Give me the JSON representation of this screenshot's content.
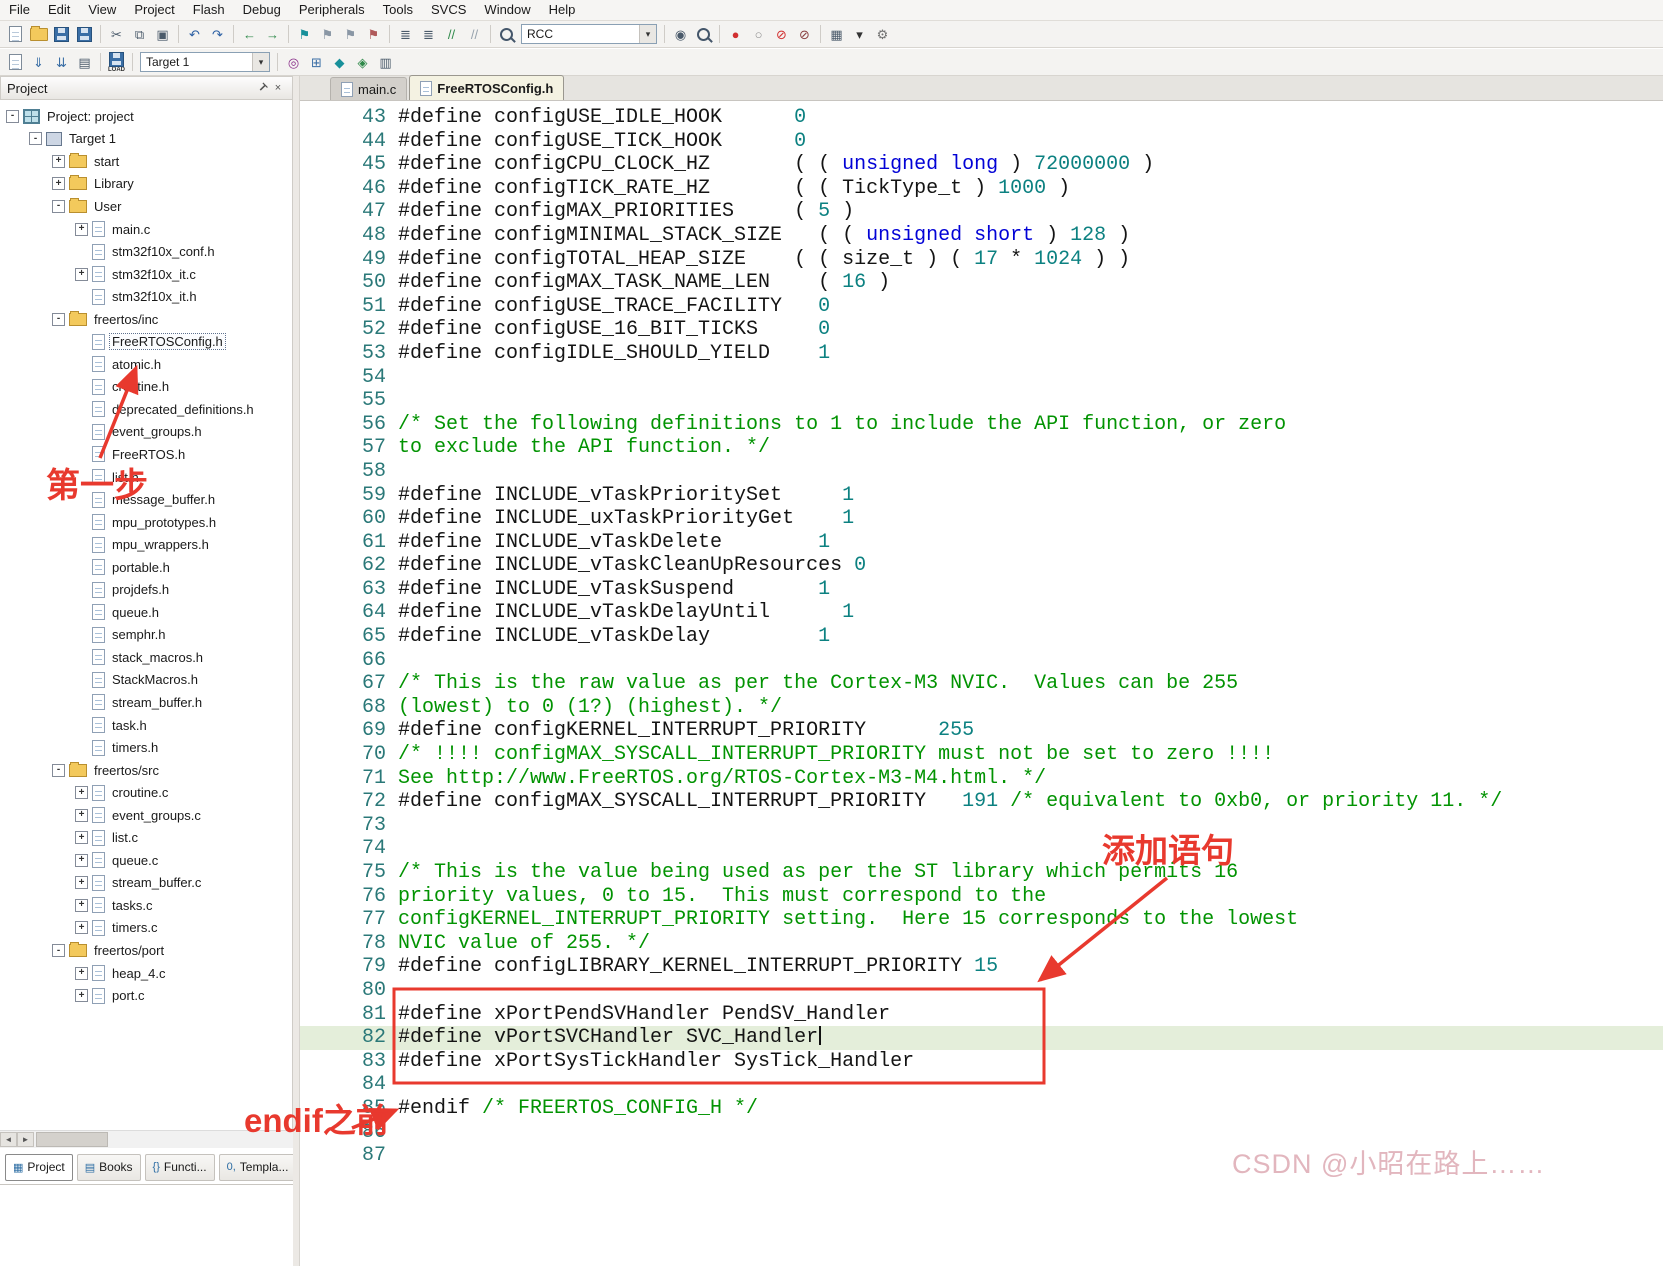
{
  "menubar": {
    "items": [
      "File",
      "Edit",
      "View",
      "Project",
      "Flash",
      "Debug",
      "Peripherals",
      "Tools",
      "SVCS",
      "Window",
      "Help"
    ]
  },
  "toolbars": {
    "row1": [
      {
        "n": "new-file-button",
        "k": "paper"
      },
      {
        "n": "open-file-button",
        "k": "folder"
      },
      {
        "n": "save-button",
        "k": "disk"
      },
      {
        "n": "save-all-button",
        "k": "disk"
      },
      {
        "k": "sep"
      },
      {
        "n": "cut-button",
        "k": "g",
        "g": "✂",
        "c": "#4a5a6a"
      },
      {
        "n": "copy-button",
        "k": "g",
        "g": "⧉",
        "c": "#4a5a6a"
      },
      {
        "n": "paste-button",
        "k": "g",
        "g": "▣",
        "c": "#4a5a6a"
      },
      {
        "k": "sep"
      },
      {
        "n": "undo-button",
        "k": "g",
        "g": "↶",
        "c": "#2b5fa3"
      },
      {
        "n": "redo-button",
        "k": "g",
        "g": "↷",
        "c": "#2b5fa3"
      },
      {
        "k": "sep"
      },
      {
        "n": "nav-back-button",
        "k": "g",
        "g": "←",
        "c": "#2f8a4a"
      },
      {
        "n": "nav-forward-button",
        "k": "g",
        "g": "→",
        "c": "#2f8a4a"
      },
      {
        "k": "sep"
      },
      {
        "n": "bookmark-toggle-button",
        "k": "g",
        "g": "⚑",
        "c": "#18909a"
      },
      {
        "n": "bookmark-prev-button",
        "k": "g",
        "g": "⚑",
        "c": "#8a97a5"
      },
      {
        "n": "bookmark-next-button",
        "k": "g",
        "g": "⚑",
        "c": "#8a97a5"
      },
      {
        "n": "bookmark-clear-button",
        "k": "g",
        "g": "⚑",
        "c": "#b05a5a"
      },
      {
        "k": "sep"
      },
      {
        "n": "indent-left-button",
        "k": "g",
        "g": "≣",
        "c": "#4a5a6a"
      },
      {
        "n": "indent-right-button",
        "k": "g",
        "g": "≣",
        "c": "#4a5a6a"
      },
      {
        "n": "comment-button",
        "k": "g",
        "g": "//",
        "c": "#2f8a4a"
      },
      {
        "n": "uncomment-button",
        "k": "g",
        "g": "//",
        "c": "#97a2ad"
      },
      {
        "k": "sep"
      },
      {
        "n": "find-icon-button",
        "k": "mag"
      },
      {
        "n": "find-combo",
        "k": "combo",
        "v": "RCC",
        "a": "▾",
        "w": 136
      },
      {
        "k": "sep"
      },
      {
        "n": "find-in-files-button",
        "k": "g",
        "g": "◉",
        "c": "#4a5a6a"
      },
      {
        "n": "search-button",
        "k": "mag"
      },
      {
        "k": "sep"
      },
      {
        "n": "breakpoint-toggle-button",
        "k": "g",
        "g": "●",
        "c": "#d23030"
      },
      {
        "n": "breakpoint-enable-button",
        "k": "g",
        "g": "○",
        "c": "#909090"
      },
      {
        "n": "breakpoint-disable-all-button",
        "k": "g",
        "g": "⊘",
        "c": "#d23030"
      },
      {
        "n": "breakpoint-kill-all-button",
        "k": "g",
        "g": "⊘",
        "c": "#8a4040"
      },
      {
        "k": "sep"
      },
      {
        "n": "window-layout-button",
        "k": "g",
        "g": "▦",
        "c": "#4a5a6a"
      },
      {
        "n": "window-layout-arrow-button",
        "k": "g",
        "g": "▾",
        "c": "#333333"
      },
      {
        "n": "configuration-button",
        "k": "g",
        "g": "⚙",
        "c": "#707070"
      }
    ],
    "row2": [
      {
        "n": "translate-button",
        "k": "paper"
      },
      {
        "n": "build-button",
        "k": "g",
        "g": "⇓",
        "c": "#3a6ea5"
      },
      {
        "n": "rebuild-button",
        "k": "g",
        "g": "⇊",
        "c": "#3a6ea5"
      },
      {
        "n": "batch-build-button",
        "k": "g",
        "g": "▤",
        "c": "#4a5a6a"
      },
      {
        "k": "sep"
      },
      {
        "n": "download-button",
        "k": "load",
        "g": "LOAD"
      },
      {
        "k": "sep"
      },
      {
        "n": "target-select",
        "k": "combo",
        "v": "Target 1",
        "a": "▾",
        "w": 130
      },
      {
        "k": "sep"
      },
      {
        "n": "options-for-target-button",
        "k": "g",
        "g": "◎",
        "c": "#8a2f8a"
      },
      {
        "n": "manage-project-items-button",
        "k": "g",
        "g": "⊞",
        "c": "#3a6ea5"
      },
      {
        "n": "manage-runtime-env-button",
        "k": "g",
        "g": "◆",
        "c": "#18909a"
      },
      {
        "n": "pack-installer-button",
        "k": "g",
        "g": "◈",
        "c": "#2f8a4a"
      },
      {
        "n": "books-button",
        "k": "g",
        "g": "▥",
        "c": "#4a5a6a"
      }
    ]
  },
  "project_panel": {
    "title": "Project",
    "pin_glyph": "T",
    "close_glyph": "×",
    "scroll_left_glyph": "◄",
    "scroll_right_glyph": "►",
    "tree": [
      {
        "l": "Project: project",
        "lvl": 0,
        "ic": "ws",
        "bx": "-"
      },
      {
        "l": "Target 1",
        "lvl": 1,
        "ic": "target",
        "bx": "-"
      },
      {
        "l": "start",
        "lvl": 2,
        "ic": "folder",
        "bx": "+"
      },
      {
        "l": "Library",
        "lvl": 2,
        "ic": "folder",
        "bx": "+"
      },
      {
        "l": "User",
        "lvl": 2,
        "ic": "folder",
        "bx": "-"
      },
      {
        "l": "main.c",
        "lvl": 3,
        "ic": "file",
        "bx": "+"
      },
      {
        "l": "stm32f10x_conf.h",
        "lvl": 3,
        "ic": "file"
      },
      {
        "l": "stm32f10x_it.c",
        "lvl": 3,
        "ic": "file",
        "bx": "+"
      },
      {
        "l": "stm32f10x_it.h",
        "lvl": 3,
        "ic": "file"
      },
      {
        "l": "freertos/inc",
        "lvl": 2,
        "ic": "folder",
        "bx": "-"
      },
      {
        "l": "FreeRTOSConfig.h",
        "lvl": 3,
        "ic": "file",
        "sel": true
      },
      {
        "l": "atomic.h",
        "lvl": 3,
        "ic": "file"
      },
      {
        "l": "croutine.h",
        "lvl": 3,
        "ic": "file"
      },
      {
        "l": "deprecated_definitions.h",
        "lvl": 3,
        "ic": "file"
      },
      {
        "l": "event_groups.h",
        "lvl": 3,
        "ic": "file"
      },
      {
        "l": "FreeRTOS.h",
        "lvl": 3,
        "ic": "file"
      },
      {
        "l": "list.h",
        "lvl": 3,
        "ic": "file"
      },
      {
        "l": "message_buffer.h",
        "lvl": 3,
        "ic": "file"
      },
      {
        "l": "mpu_prototypes.h",
        "lvl": 3,
        "ic": "file"
      },
      {
        "l": "mpu_wrappers.h",
        "lvl": 3,
        "ic": "file"
      },
      {
        "l": "portable.h",
        "lvl": 3,
        "ic": "file"
      },
      {
        "l": "projdefs.h",
        "lvl": 3,
        "ic": "file"
      },
      {
        "l": "queue.h",
        "lvl": 3,
        "ic": "file"
      },
      {
        "l": "semphr.h",
        "lvl": 3,
        "ic": "file"
      },
      {
        "l": "stack_macros.h",
        "lvl": 3,
        "ic": "file"
      },
      {
        "l": "StackMacros.h",
        "lvl": 3,
        "ic": "file"
      },
      {
        "l": "stream_buffer.h",
        "lvl": 3,
        "ic": "file"
      },
      {
        "l": "task.h",
        "lvl": 3,
        "ic": "file"
      },
      {
        "l": "timers.h",
        "lvl": 3,
        "ic": "file"
      },
      {
        "l": "freertos/src",
        "lvl": 2,
        "ic": "folder",
        "bx": "-"
      },
      {
        "l": "croutine.c",
        "lvl": 3,
        "ic": "file",
        "bx": "+"
      },
      {
        "l": "event_groups.c",
        "lvl": 3,
        "ic": "file",
        "bx": "+"
      },
      {
        "l": "list.c",
        "lvl": 3,
        "ic": "file",
        "bx": "+"
      },
      {
        "l": "queue.c",
        "lvl": 3,
        "ic": "file",
        "bx": "+"
      },
      {
        "l": "stream_buffer.c",
        "lvl": 3,
        "ic": "file",
        "bx": "+"
      },
      {
        "l": "tasks.c",
        "lvl": 3,
        "ic": "file",
        "bx": "+"
      },
      {
        "l": "timers.c",
        "lvl": 3,
        "ic": "file",
        "bx": "+"
      },
      {
        "l": "freertos/port",
        "lvl": 2,
        "ic": "folder",
        "bx": "-"
      },
      {
        "l": "heap_4.c",
        "lvl": 3,
        "ic": "file",
        "bx": "+"
      },
      {
        "l": "port.c",
        "lvl": 3,
        "ic": "file",
        "bx": "+"
      }
    ]
  },
  "editor": {
    "tabs": [
      {
        "label": "main.c"
      },
      {
        "label": "FreeRTOSConfig.h",
        "active": true
      }
    ],
    "lines": [
      {
        "n": 43,
        "s": [
          [
            "p",
            "#define configUSE_IDLE_HOOK      "
          ],
          [
            "n",
            "0"
          ]
        ]
      },
      {
        "n": 44,
        "s": [
          [
            "p",
            "#define configUSE_TICK_HOOK      "
          ],
          [
            "n",
            "0"
          ]
        ]
      },
      {
        "n": 45,
        "s": [
          [
            "p",
            "#define configCPU_CLOCK_HZ       ( ( "
          ],
          [
            "k",
            "unsigned long"
          ],
          [
            "p",
            " ) "
          ],
          [
            "n",
            "72000000"
          ],
          [
            "p",
            " )"
          ]
        ]
      },
      {
        "n": 46,
        "s": [
          [
            "p",
            "#define configTICK_RATE_HZ       ( ( TickType_t ) "
          ],
          [
            "n",
            "1000"
          ],
          [
            "p",
            " )"
          ]
        ]
      },
      {
        "n": 47,
        "s": [
          [
            "p",
            "#define configMAX_PRIORITIES     ( "
          ],
          [
            "n",
            "5"
          ],
          [
            "p",
            " )"
          ]
        ]
      },
      {
        "n": 48,
        "s": [
          [
            "p",
            "#define configMINIMAL_STACK_SIZE   ( ( "
          ],
          [
            "k",
            "unsigned short"
          ],
          [
            "p",
            " ) "
          ],
          [
            "n",
            "128"
          ],
          [
            "p",
            " )"
          ]
        ]
      },
      {
        "n": 49,
        "s": [
          [
            "p",
            "#define configTOTAL_HEAP_SIZE    ( ( size_t ) ( "
          ],
          [
            "n",
            "17"
          ],
          [
            "p",
            " * "
          ],
          [
            "n",
            "1024"
          ],
          [
            "p",
            " ) )"
          ]
        ]
      },
      {
        "n": 50,
        "s": [
          [
            "p",
            "#define configMAX_TASK_NAME_LEN    ( "
          ],
          [
            "n",
            "16"
          ],
          [
            "p",
            " )"
          ]
        ]
      },
      {
        "n": 51,
        "s": [
          [
            "p",
            "#define configUSE_TRACE_FACILITY   "
          ],
          [
            "n",
            "0"
          ]
        ]
      },
      {
        "n": 52,
        "s": [
          [
            "p",
            "#define configUSE_16_BIT_TICKS     "
          ],
          [
            "n",
            "0"
          ]
        ]
      },
      {
        "n": 53,
        "s": [
          [
            "p",
            "#define configIDLE_SHOULD_YIELD    "
          ],
          [
            "n",
            "1"
          ]
        ]
      },
      {
        "n": 54,
        "s": []
      },
      {
        "n": 55,
        "s": []
      },
      {
        "n": 56,
        "s": [
          [
            "c",
            "/* Set the following definitions to 1 to include the API function, or zero"
          ]
        ]
      },
      {
        "n": 57,
        "s": [
          [
            "c",
            "to exclude the API function. */"
          ]
        ]
      },
      {
        "n": 58,
        "s": []
      },
      {
        "n": 59,
        "s": [
          [
            "p",
            "#define INCLUDE_vTaskPrioritySet     "
          ],
          [
            "n",
            "1"
          ]
        ]
      },
      {
        "n": 60,
        "s": [
          [
            "p",
            "#define INCLUDE_uxTaskPriorityGet    "
          ],
          [
            "n",
            "1"
          ]
        ]
      },
      {
        "n": 61,
        "s": [
          [
            "p",
            "#define INCLUDE_vTaskDelete        "
          ],
          [
            "n",
            "1"
          ]
        ]
      },
      {
        "n": 62,
        "s": [
          [
            "p",
            "#define INCLUDE_vTaskCleanUpResources "
          ],
          [
            "n",
            "0"
          ]
        ]
      },
      {
        "n": 63,
        "s": [
          [
            "p",
            "#define INCLUDE_vTaskSuspend       "
          ],
          [
            "n",
            "1"
          ]
        ]
      },
      {
        "n": 64,
        "s": [
          [
            "p",
            "#define INCLUDE_vTaskDelayUntil      "
          ],
          [
            "n",
            "1"
          ]
        ]
      },
      {
        "n": 65,
        "s": [
          [
            "p",
            "#define INCLUDE_vTaskDelay         "
          ],
          [
            "n",
            "1"
          ]
        ]
      },
      {
        "n": 66,
        "s": []
      },
      {
        "n": 67,
        "s": [
          [
            "c",
            "/* This is the raw value as per the Cortex-M3 NVIC.  Values can be 255"
          ]
        ]
      },
      {
        "n": 68,
        "s": [
          [
            "c",
            "(lowest) to 0 (1?) (highest). */"
          ]
        ]
      },
      {
        "n": 69,
        "s": [
          [
            "p",
            "#define configKERNEL_INTERRUPT_PRIORITY      "
          ],
          [
            "n",
            "255"
          ]
        ]
      },
      {
        "n": 70,
        "s": [
          [
            "c",
            "/* !!!! configMAX_SYSCALL_INTERRUPT_PRIORITY must not be set to zero !!!!"
          ]
        ]
      },
      {
        "n": 71,
        "s": [
          [
            "c",
            "See http://www.FreeRTOS.org/RTOS-Cortex-M3-M4.html. */"
          ]
        ]
      },
      {
        "n": 72,
        "s": [
          [
            "p",
            "#define configMAX_SYSCALL_INTERRUPT_PRIORITY   "
          ],
          [
            "n",
            "191"
          ],
          [
            "p",
            " "
          ],
          [
            "c",
            "/* equivalent to 0xb0, or priority 11. */"
          ]
        ]
      },
      {
        "n": 73,
        "s": []
      },
      {
        "n": 74,
        "s": []
      },
      {
        "n": 75,
        "s": [
          [
            "c",
            "/* This is the value being used as per the ST library which permits 16"
          ]
        ]
      },
      {
        "n": 76,
        "s": [
          [
            "c",
            "priority values, 0 to 15.  This must correspond to the"
          ]
        ]
      },
      {
        "n": 77,
        "s": [
          [
            "c",
            "configKERNEL_INTERRUPT_PRIORITY setting.  Here 15 corresponds to the lowest"
          ]
        ]
      },
      {
        "n": 78,
        "s": [
          [
            "c",
            "NVIC value of 255. */"
          ]
        ]
      },
      {
        "n": 79,
        "s": [
          [
            "p",
            "#define configLIBRARY_KERNEL_INTERRUPT_PRIORITY "
          ],
          [
            "n",
            "15"
          ]
        ]
      },
      {
        "n": 80,
        "s": []
      },
      {
        "n": 81,
        "s": [
          [
            "p",
            "#define xPortPendSVHandler PendSV_Handler"
          ]
        ]
      },
      {
        "n": 82,
        "s": [
          [
            "p",
            "#define vPortSVCHandler SVC_Handler"
          ]
        ],
        "hl": true,
        "caret": true
      },
      {
        "n": 83,
        "s": [
          [
            "p",
            "#define xPortSysTickHandler SysTick_Handler"
          ]
        ]
      },
      {
        "n": 84,
        "s": []
      },
      {
        "n": 85,
        "s": [
          [
            "p",
            "#endif "
          ],
          [
            "c",
            "/* FREERTOS_CONFIG_H */"
          ]
        ]
      },
      {
        "n": 86,
        "s": []
      },
      {
        "n": 87,
        "s": []
      }
    ]
  },
  "bottom_tabs": [
    {
      "label": "Project",
      "icon": "▦",
      "active": true
    },
    {
      "label": "Books",
      "icon": "▤"
    },
    {
      "label": "Functi...",
      "icon": "{}"
    },
    {
      "label": "Templa...",
      "icon": "0,"
    }
  ],
  "annotations": {
    "step1": "第一步",
    "add_statement": "添加语句",
    "before_endif": "endif之前"
  },
  "watermark": "CSDN @小昭在路上……",
  "colors": {
    "annotation_red": "#e8392e",
    "keyword_blue": "#0202d6",
    "number_teal": "#0c8181",
    "comment_green": "#029302",
    "line_number_teal": "#2a7878",
    "current_line_bg": "#e4eeda"
  }
}
